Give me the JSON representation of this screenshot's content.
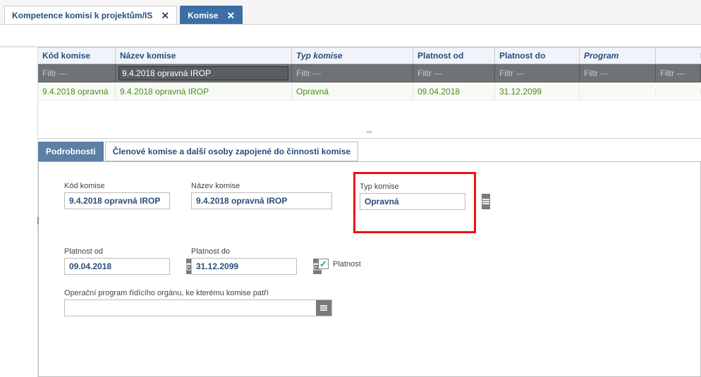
{
  "tabs": {
    "kompetence": "Kompetence komisí k projektům/IS",
    "komise": "Komise"
  },
  "grid": {
    "headers": {
      "kod": "Kód komise",
      "nazev": "Název komise",
      "typ": "Typ komise",
      "platnost_od": "Platnost od",
      "platnost_do": "Platnost do",
      "program": "Program"
    },
    "filter_placeholder": "Filtr ---",
    "filter_nazev_value": "9.4.2018 opravná IROP",
    "row": {
      "kod": "9.4.2018 opravná",
      "nazev": "9.4.2018 opravná IROP",
      "typ": "Opravná",
      "platnost_od": "09.04.2018",
      "platnost_do": "31.12.2099",
      "program": ""
    }
  },
  "detail_tabs": {
    "podrobnosti": "Podrobnosti",
    "clenove": "Členové komise a další osoby zapojené do činnosti komise"
  },
  "form": {
    "kod_label": "Kód komise",
    "kod_value": "9.4.2018 opravná IROP",
    "nazev_label": "Název komise",
    "nazev_value": "9.4.2018 opravná IROP",
    "typ_label": "Typ komise",
    "typ_value": "Opravná",
    "platnost_od_label": "Platnost od",
    "platnost_od_value": "09.04.2018",
    "platnost_do_label": "Platnost do",
    "platnost_do_value": "31.12.2099",
    "platnost_checkbox_label": "Platnost",
    "platnost_checked": true,
    "program_label": "Operační program řídícího orgánu, ke kterému komise patří",
    "program_value": ""
  }
}
